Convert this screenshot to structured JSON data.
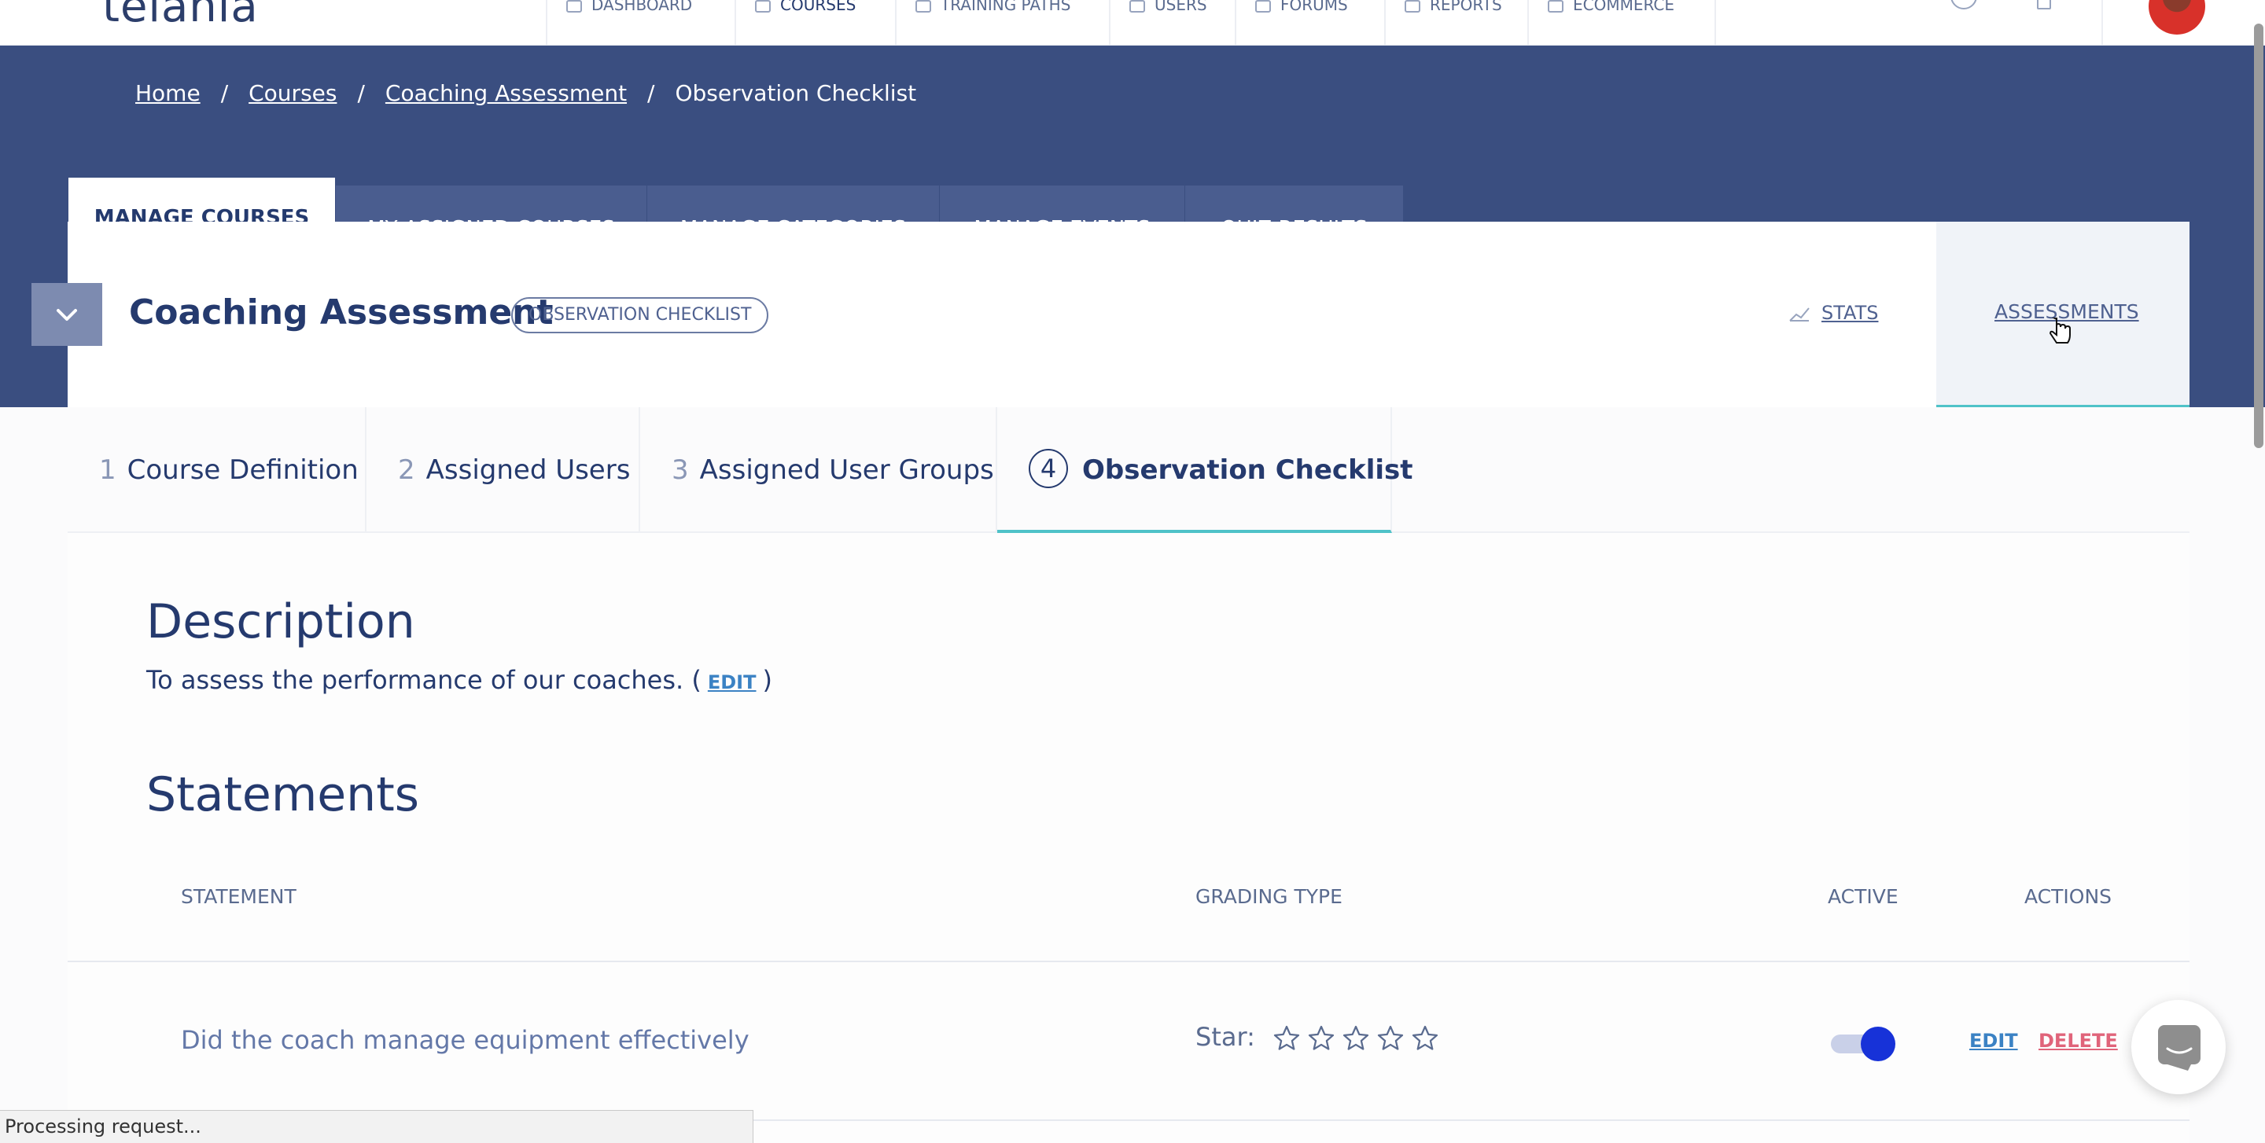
{
  "app": {
    "logo": "telania"
  },
  "topnav": {
    "items": [
      "DASHBOARD",
      "COURSES",
      "TRAINING PATHS",
      "USERS",
      "FORUMS",
      "REPORTS",
      "ECOMMERCE"
    ]
  },
  "breadcrumb": {
    "items": [
      "Home",
      "Courses",
      "Coaching Assessment"
    ],
    "current": "Observation Checklist",
    "separator": "/"
  },
  "main_tabs": [
    "MANAGE COURSES",
    "MY ASSIGNED COURSES",
    "MANAGE CATEGORIES",
    "MANAGE EVENTS",
    "QUIZ RESULTS"
  ],
  "header": {
    "title": "Coaching Assessment",
    "badge": "OBSERVATION CHECKLIST",
    "stats_label": "STATS",
    "assessments_label": "ASSESSMENTS"
  },
  "steps": [
    {
      "num": "1",
      "label": "Course Definition"
    },
    {
      "num": "2",
      "label": "Assigned Users"
    },
    {
      "num": "3",
      "label": "Assigned User Groups"
    },
    {
      "num": "4",
      "label": "Observation Checklist"
    }
  ],
  "description": {
    "heading": "Description",
    "text": "To assess the performance of our coaches.",
    "open_paren": "(",
    "edit_label": "EDIT",
    "close_paren": ")"
  },
  "statements": {
    "heading": "Statements",
    "columns": [
      "STATEMENT",
      "GRADING TYPE",
      "ACTIVE",
      "ACTIONS"
    ],
    "rows": [
      {
        "statement": "Did the coach manage equipment effectively",
        "grading_type": "Star:",
        "star_rating": {
          "filled": 0,
          "max": 5
        },
        "active": true,
        "edit_label": "EDIT",
        "delete_label": "DELETE"
      }
    ]
  },
  "status_bar": {
    "text": "Processing request..."
  },
  "colors": {
    "hero": "#3a4e80",
    "accent_teal": "#4fc2c8",
    "link_blue": "#3b82c4",
    "delete_red": "#e0647a",
    "toggle_on": "#1732d8"
  }
}
